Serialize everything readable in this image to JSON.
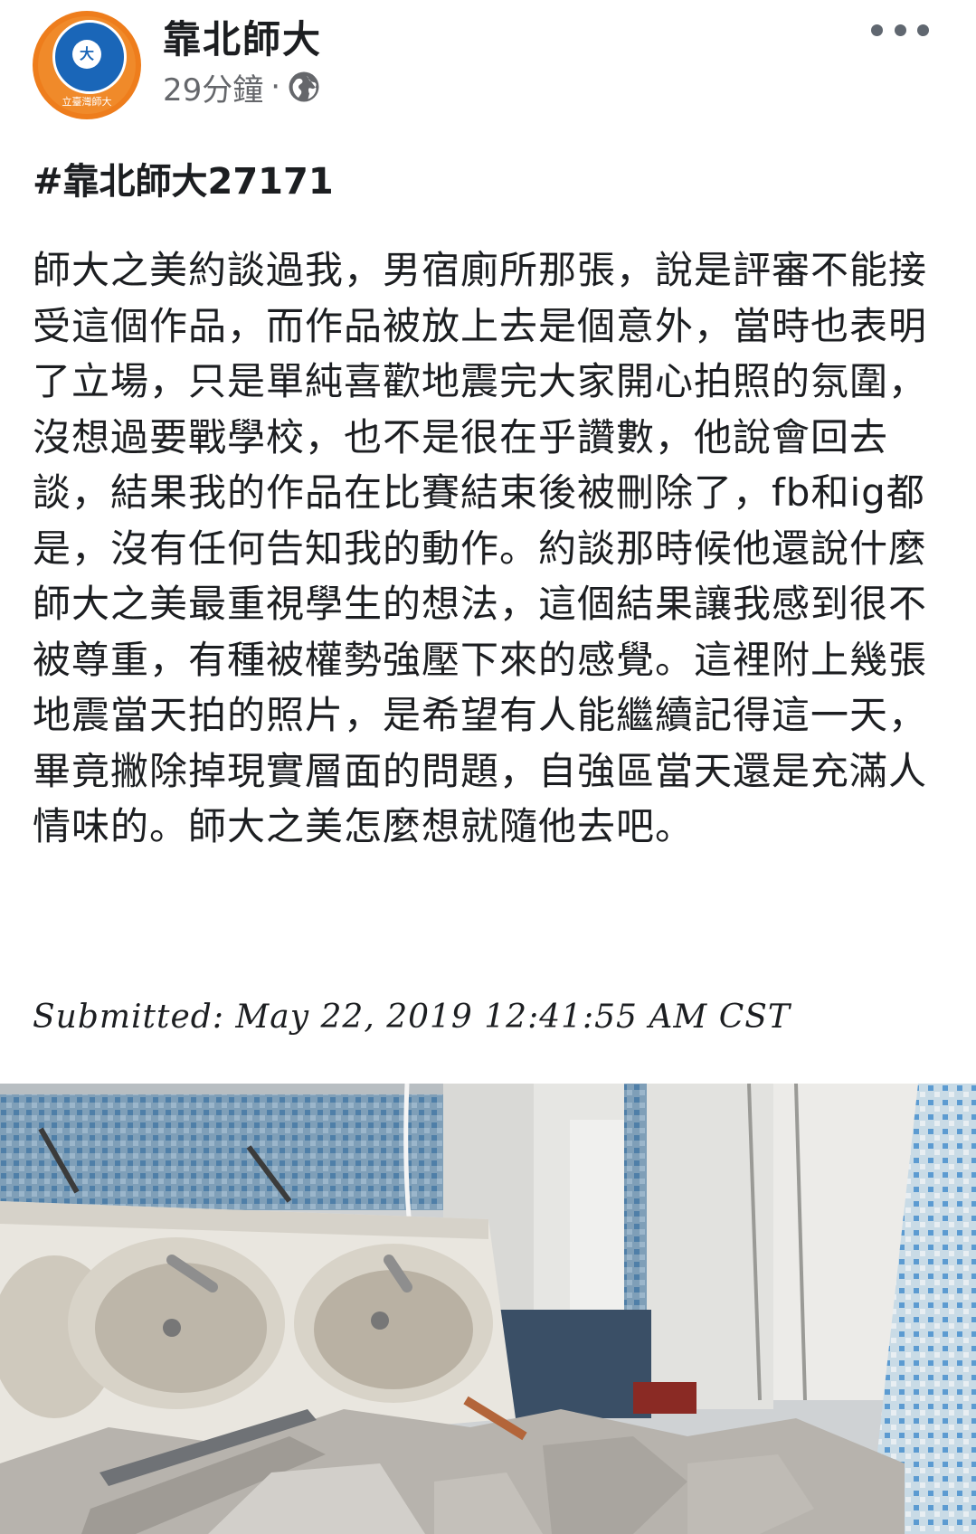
{
  "header": {
    "page_name": "靠北師大",
    "timestamp": "29分鐘",
    "separator": "·",
    "avatar_text": "大",
    "avatar_caption": "立臺灣師大"
  },
  "post": {
    "hashtag": "#靠北師大27171",
    "body": "師大之美約談過我，男宿廁所那張，說是評審不能接受這個作品，而作品被放上去是個意外，當時也表明了立場，只是單純喜歡地震完大家開心拍照的氛圍，沒想過要戰學校，也不是很在乎讚數，他說會回去談，結果我的作品在比賽結束後被刪除了，fb和ig都是，沒有任何告知我的動作。約談那時候他還說什麼師大之美最重視學生的想法，這個結果讓我感到很不被尊重，有種被權勢強壓下來的感覺。這裡附上幾張地震當天拍的照片，是希望有人能繼續記得這一天，畢竟撇除掉現實層面的問題，自強區當天還是充滿人情味的。師大之美怎麼想就隨他去吧。",
    "submitted": "Submitted: May 22, 2019 12:41:55 AM CST"
  },
  "icons": {
    "globe": "globe-icon",
    "more": "more-options-icon"
  },
  "colors": {
    "avatar_orange": "#ee7d1c",
    "avatar_blue": "#1a66b8",
    "meta_gray": "#65676b",
    "text": "#1c1e21"
  }
}
